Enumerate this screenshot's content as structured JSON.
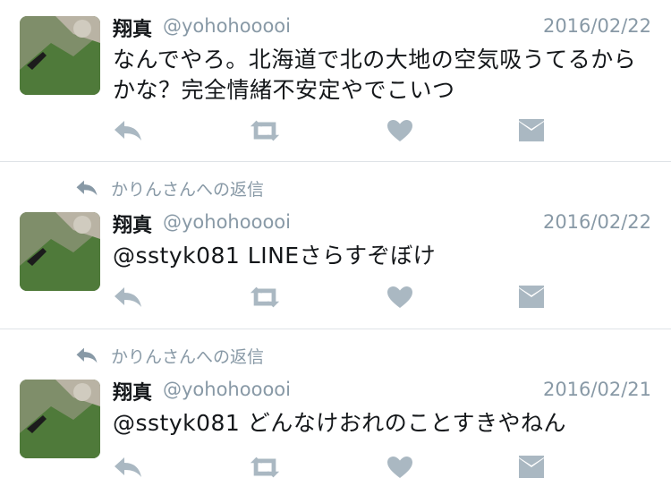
{
  "colors": {
    "icon_gray": "#aab8c2",
    "meta_gray": "#8899a6",
    "text": "#14171a",
    "divider": "#dfe3e7"
  },
  "tweets": [
    {
      "reply_context": "",
      "name": "翔真",
      "handle": "@yohohooooi",
      "date": "2016/02/22",
      "text_lines": [
        "なんでやろ。北海道で北の大地の空気吸うてるから",
        "かな？完全情緒不安定やでこいつ"
      ]
    },
    {
      "reply_context": "かりんさんへの返信",
      "name": "翔真",
      "handle": "@yohohooooi",
      "date": "2016/02/22",
      "text_lines": [
        "@sstyk081 LINEさらすぞぼけ"
      ]
    },
    {
      "reply_context": "かりんさんへの返信",
      "name": "翔真",
      "handle": "@yohohooooi",
      "date": "2016/02/21",
      "text_lines": [
        "@sstyk081 どんなけおれのことすきやねん"
      ]
    }
  ],
  "icons": {
    "reply": "reply-icon",
    "retweet": "retweet-icon",
    "like": "heart-icon",
    "dm": "envelope-icon"
  }
}
